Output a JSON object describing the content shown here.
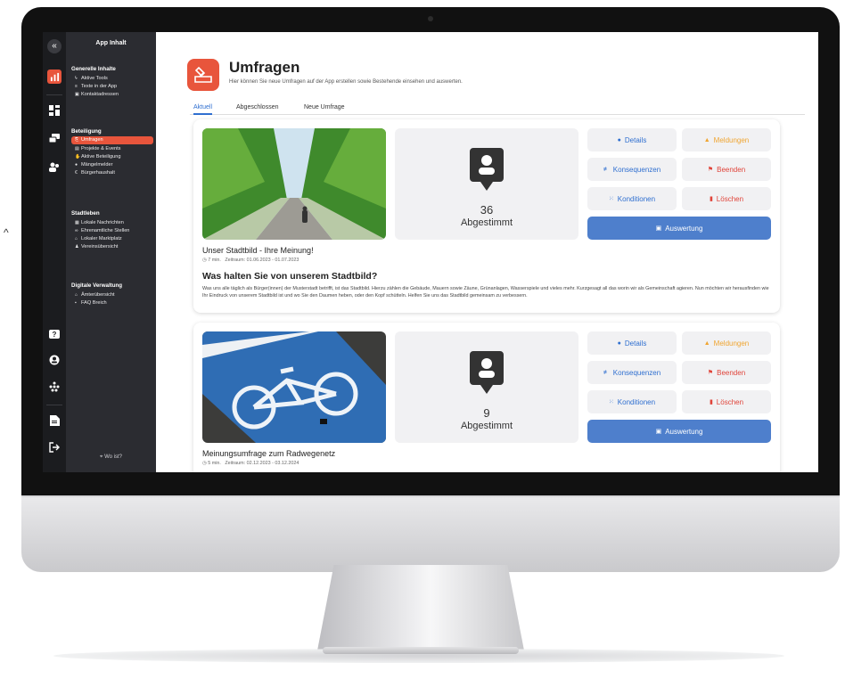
{
  "sidebar": {
    "title": "App Inhalt",
    "sections": [
      {
        "title": "Generelle Inhalte",
        "items": [
          {
            "label": "Aktive Tools",
            "icon": "bolt-icon"
          },
          {
            "label": "Texte in der App",
            "icon": "text-lines-icon"
          },
          {
            "label": "Kontaktadressen",
            "icon": "contact-card-icon"
          }
        ]
      },
      {
        "title": "Beteiligung",
        "items": [
          {
            "label": "Umfragen",
            "icon": "ballot-icon",
            "active": true
          },
          {
            "label": "Projekte & Events",
            "icon": "calendar-icon"
          },
          {
            "label": "Aktive Beteiligung",
            "icon": "hand-icon"
          },
          {
            "label": "Mängelmelder",
            "icon": "warning-icon"
          },
          {
            "label": "Bürgerhaushalt",
            "icon": "euro-icon"
          }
        ]
      },
      {
        "title": "Stadtleben",
        "items": [
          {
            "label": "Lokale Nachrichten",
            "icon": "news-icon"
          },
          {
            "label": "Ehrenamtliche Stellen",
            "icon": "handshake-icon"
          },
          {
            "label": "Lokaler Marktplatz",
            "icon": "shop-icon"
          },
          {
            "label": "Vereinsübersicht",
            "icon": "group-icon"
          }
        ]
      },
      {
        "title": "Digitale Verwaltung",
        "items": [
          {
            "label": "Ämterübersicht",
            "icon": "building-icon"
          },
          {
            "label": "FAQ Breich",
            "icon": "faq-icon"
          }
        ]
      }
    ],
    "footer_link": "Wo ist?"
  },
  "header": {
    "title": "Umfragen",
    "subtitle": "Hier können Sie neue Umfragen auf der App erstellen sowie Bestehende einsehen und auswerten."
  },
  "tabs": [
    {
      "label": "Aktuell",
      "active": true
    },
    {
      "label": "Abgeschlossen"
    },
    {
      "label": "Neue Umfrage"
    }
  ],
  "polls": [
    {
      "votes": "36",
      "votes_label": "Abgestimmt",
      "title": "Unser Stadtbild - Ihre Meinung!",
      "duration": "7 min.",
      "period": "Zeitraum: 01.06.2023 - 01.07.2023",
      "question": "Was halten Sie von unserem Stadtbild?",
      "description": "Was uns alle täglich als Bürger(innen) der Musterstadt betrifft, ist das Stadtbild. Hierzu zählen die Gebäude, Mauern sowie Zäune, Grünanlagen, Wasserspiele und vieles mehr. Kurzgesagt all das worin wir als Gemeinschaft agieren. Nun möchten wir herausfinden wie Ihr Eindruck von unserem Stadtbild ist und wo Sie den Daumen heben, oder den Kopf schütteln. Helfen Sie uns das Stadtbild gemeinsam zu verbessern.",
      "image": "tree-lined-avenue-photo"
    },
    {
      "votes": "9",
      "votes_label": "Abgestimmt",
      "title": "Meinungsumfrage zum Radwegenetz",
      "duration": "5 min.",
      "period": "Zeitraum: 02.12.2023 - 03.12.2024",
      "image": "bike-lane-photo"
    }
  ],
  "actions": {
    "details": "Details",
    "meldungen": "Meldungen",
    "konsequenzen": "Konsequenzen",
    "beenden": "Beenden",
    "konditionen": "Konditionen",
    "loeschen": "Löschen",
    "auswertung": "Auswertung"
  },
  "colors": {
    "accent": "#e8553c",
    "primary_button": "#4e7fcc",
    "link_blue": "#2f6fd0",
    "warning_orange": "#f0a531",
    "danger_red": "#e0443a",
    "sidebar_bg": "#2b2c31",
    "rail_bg": "#1b1c1f"
  }
}
